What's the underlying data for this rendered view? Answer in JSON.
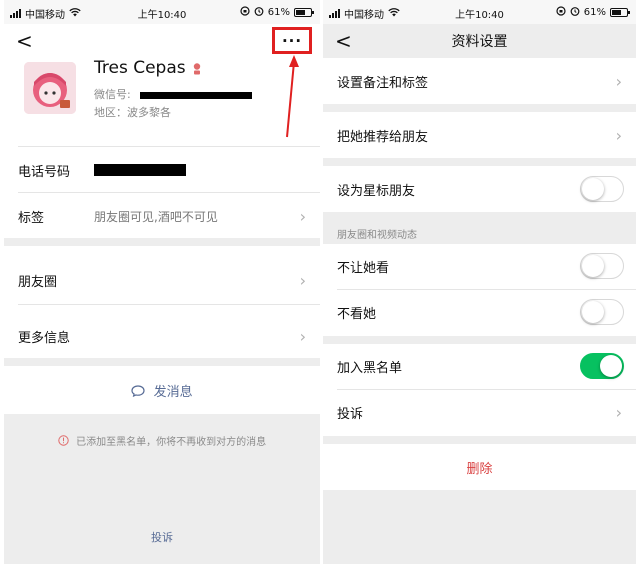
{
  "status": {
    "carrier": "中国移动",
    "time": "上午10:40",
    "battery": "61%",
    "battery_level": 0.61
  },
  "profile_page": {
    "name": "Tres Cepas",
    "wechat_id_label": "微信号:",
    "region": "地区：波多黎各",
    "phone_label": "电话号码",
    "tags_label": "标签",
    "tags_value": "朋友圈可见,酒吧不可见",
    "moments_label": "朋友圈",
    "more_info_label": "更多信息",
    "send_message": "发消息",
    "blacklist_notice": "已添加至黑名单，你将不再收到对方的消息",
    "report": "投诉",
    "more_button": "···"
  },
  "settings_page": {
    "title": "资料设置",
    "items": {
      "remark_tags": "设置备注和标签",
      "recommend": "把她推荐给朋友",
      "star_friend": "设为星标朋友",
      "moments_caption": "朋友圈和视频动态",
      "hide_from_her": "不让她看",
      "hide_her": "不看她",
      "blacklist": "加入黑名单",
      "report": "投诉",
      "delete": "删除"
    },
    "toggles": {
      "star_friend": false,
      "hide_from_her": false,
      "hide_her": false,
      "blacklist": true
    }
  },
  "colors": {
    "accent_green": "#07c160",
    "link_blue": "#576b95",
    "delete_red": "#d94040",
    "highlight_red": "#e02020"
  }
}
